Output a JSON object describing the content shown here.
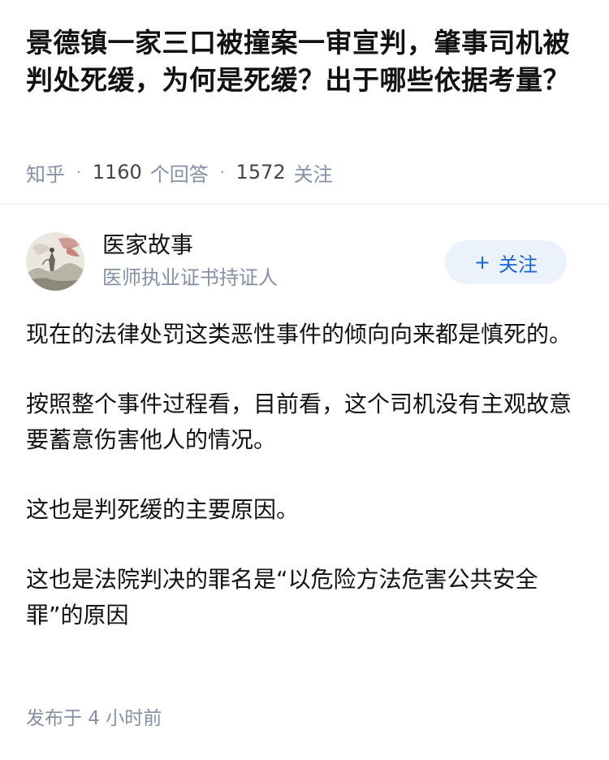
{
  "question": {
    "title": "景德镇一家三口被撞案一审宣判，肇事司机被判处死缓，为何是死缓？出于哪些依据考量？",
    "source": "知乎",
    "answers_count": "1160",
    "answers_label": "个回答",
    "followers_count": "1572",
    "followers_label": "关注",
    "separator": "·"
  },
  "author": {
    "name": "医家故事",
    "badge": "医师执业证书持证人",
    "follow_plus": "+",
    "follow_label": "关注"
  },
  "answer": {
    "paragraphs": [
      "现在的法律处罚这类恶性事件的倾向向来都是慎死的。",
      "按照整个事件过程看，目前看，这个司机没有主观故意要蓄意伤害他人的情况。",
      "这也是判死缓的主要原因。",
      "这也是法院判决的罪名是“以危险方法危害公共安全罪”的原因"
    ],
    "posted": "发布于 4 小时前"
  },
  "colors": {
    "text_primary": "#121212",
    "text_secondary": "#8590a6",
    "accent": "#1766d6",
    "button_bg": "#ebf2fb"
  }
}
